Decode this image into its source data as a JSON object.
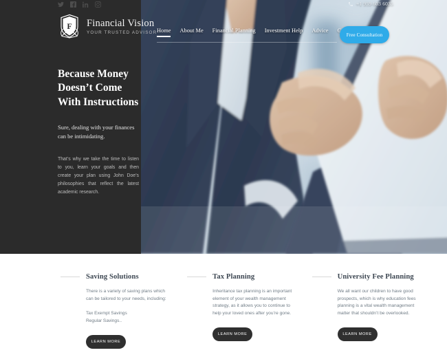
{
  "topbar": {
    "social": [
      {
        "name": "twitter-icon",
        "label": "Twitter"
      },
      {
        "name": "facebook-icon",
        "label": "Facebook"
      },
      {
        "name": "linkedin-icon",
        "label": "LinkedIn"
      },
      {
        "name": "instagram-icon",
        "label": "Instagram"
      }
    ],
    "phone": "+1 959 603 6035",
    "phone_icon": "phone-icon"
  },
  "brand": {
    "logo_icon": "shield-laurel-logo",
    "monogram": "F",
    "name": "Financial Vision",
    "tagline": "YOUR TRUSTED ADVISOR"
  },
  "nav": {
    "items": [
      {
        "label": "Home",
        "active": true
      },
      {
        "label": "About Me",
        "active": false
      },
      {
        "label": "Financial Planning",
        "active": false
      },
      {
        "label": "Investment Help",
        "active": false
      },
      {
        "label": "Advice",
        "active": false
      },
      {
        "label": "Contacts",
        "active": false
      }
    ],
    "cta_label": "Free Consultation",
    "cta_color": "#2fabe9"
  },
  "hero": {
    "headline_line1": "Because Money",
    "headline_line2": "Doesn’t Come",
    "headline_line3": "With Instructions",
    "subhead": "Sure, dealing with your finances can be intimidating.",
    "paragraph": "That’s why we take the time to listen to you, learn your goals and then create your plan using John Doe’s philosophies that reflect the latest academic research.",
    "image_alt": "Businessman in navy suit using a white tablet in a blurred office",
    "panel_color": "#2b2b2b"
  },
  "features": {
    "columns": [
      {
        "title": "Saving Solutions",
        "paragraph1": "There is a variety of saving plans which can be tailored to your needs, including:",
        "paragraph2": "Tax Exempt Savings\nRegular Savings..",
        "button": "LEARN MORE"
      },
      {
        "title": "Tax Planning",
        "paragraph1": "Inheritance tax planning is an important element of your wealth management strategy, as it allows you to continue to help your loved ones after you’re gone.",
        "paragraph2": "",
        "button": "LEARN MORE"
      },
      {
        "title": "University Fee Planning",
        "paragraph1": "We all want our children to have good prospects, which is why education fees planning is a vital wealth management matter that shouldn’t be overlooked.",
        "paragraph2": "",
        "button": "LEARN MORE"
      }
    ]
  }
}
